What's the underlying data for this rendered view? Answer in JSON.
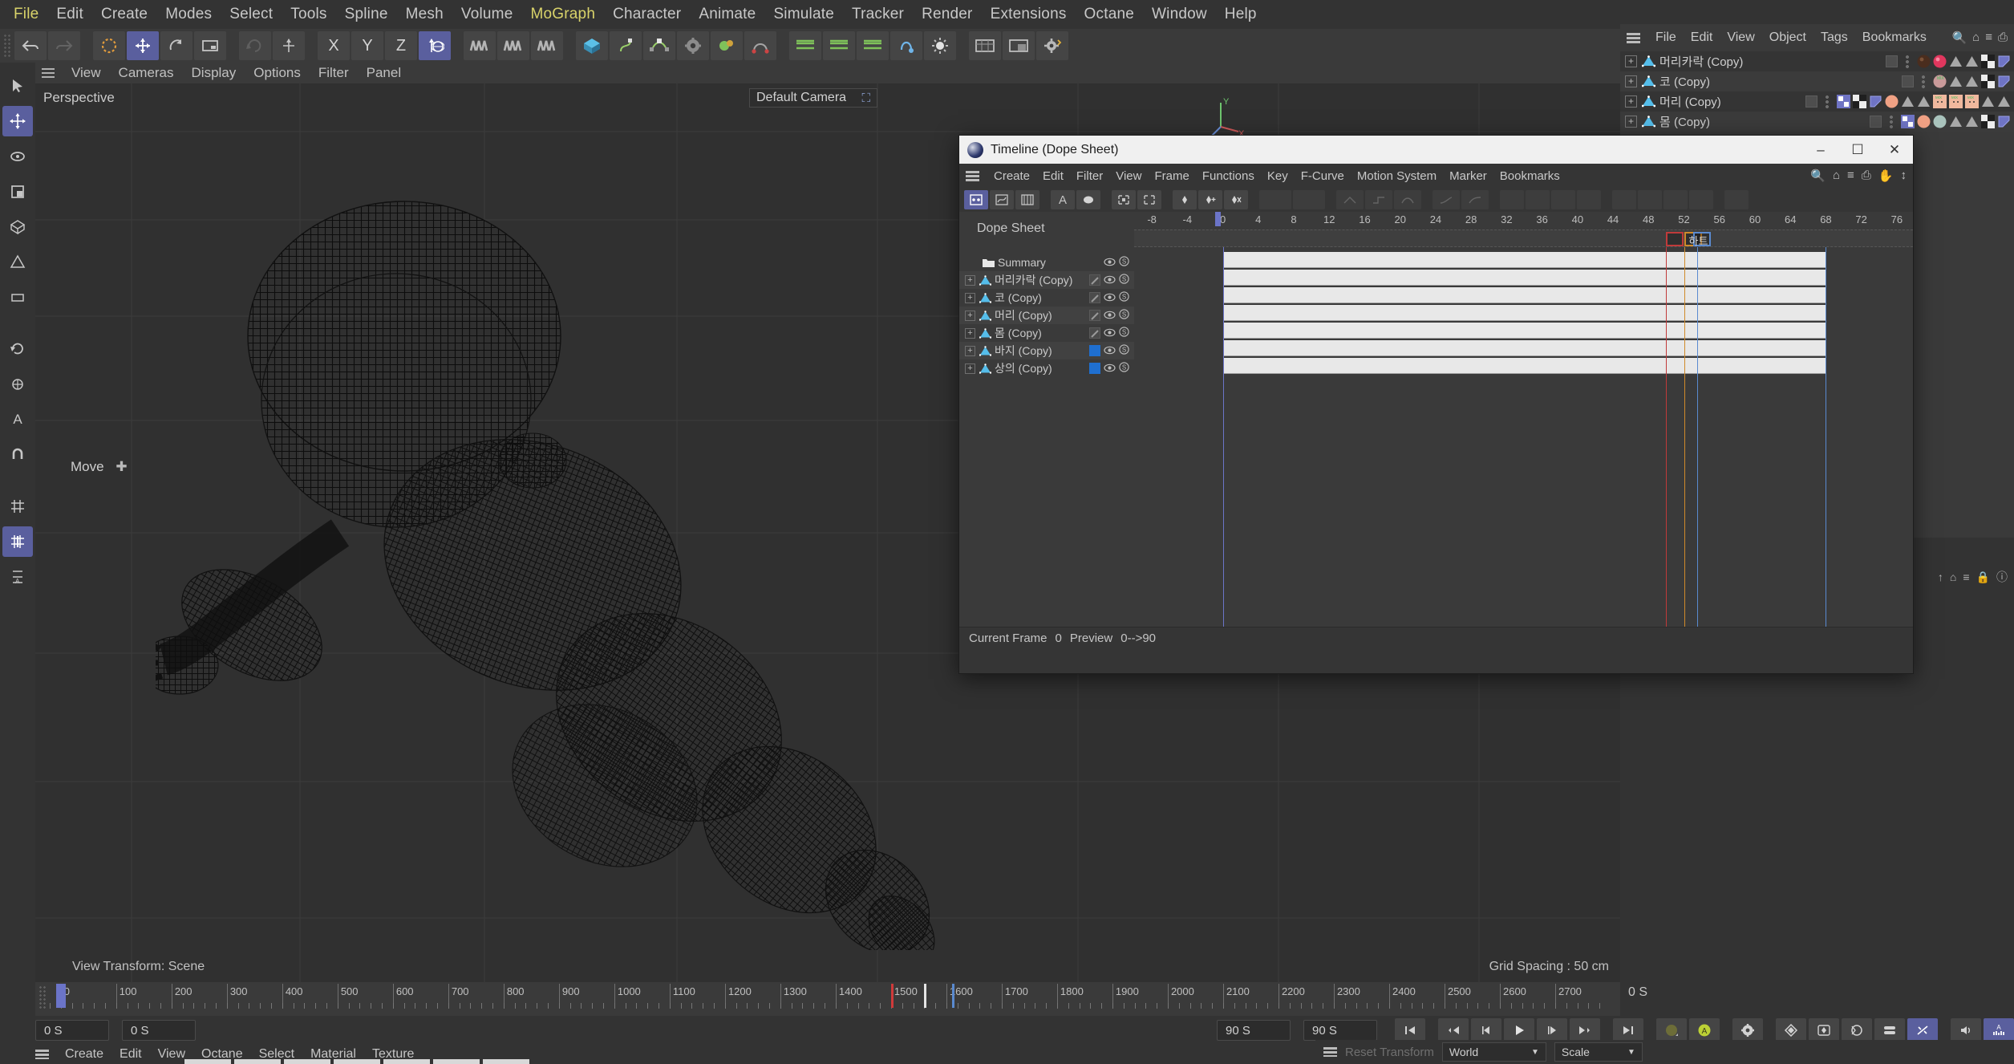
{
  "app": {
    "menu": [
      "File",
      "Edit",
      "Create",
      "Modes",
      "Select",
      "Tools",
      "Spline",
      "Mesh",
      "Volume",
      "MoGraph",
      "Character",
      "Animate",
      "Simulate",
      "Tracker",
      "Render",
      "Extensions",
      "Octane",
      "Window",
      "Help"
    ],
    "accent_menu": "MoGraph",
    "accent_color": "#d9d36a"
  },
  "viewport": {
    "header_menu": [
      "View",
      "Cameras",
      "Display",
      "Options",
      "Filter",
      "Panel"
    ],
    "perspective_label": "Perspective",
    "camera_value": "Default Camera",
    "tool_label": "Move",
    "view_transform": "View Transform: Scene",
    "grid_spacing": "Grid Spacing : 50 cm",
    "axis_labels": [
      "Y",
      "X",
      "Z"
    ]
  },
  "object_manager": {
    "menu": [
      "File",
      "Edit",
      "View",
      "Object",
      "Tags",
      "Bookmarks"
    ],
    "icons": [
      "search-icon",
      "home-icon",
      "filter-icon",
      "expand-icon"
    ],
    "rows": [
      {
        "name": "머리카락 (Copy)"
      },
      {
        "name": "코 (Copy)"
      },
      {
        "name": "머리 (Copy)"
      },
      {
        "name": "몸 (Copy)"
      }
    ]
  },
  "timeline": {
    "title": "Timeline (Dope Sheet)",
    "window_buttons": [
      "minimize",
      "maximize",
      "close"
    ],
    "menu": [
      "Create",
      "Edit",
      "Filter",
      "View",
      "Frame",
      "Functions",
      "Key",
      "F-Curve",
      "Motion System",
      "Marker",
      "Bookmarks"
    ],
    "icons": [
      "search-icon",
      "home-icon",
      "filter-icon",
      "popout-icon",
      "hand-icon",
      "updown-icon"
    ],
    "mode_label": "Dope Sheet",
    "rows": [
      {
        "name": "Summary",
        "type": "folder",
        "swatch": "none"
      },
      {
        "name": "머리카락 (Copy)",
        "type": "object",
        "swatch": "grey"
      },
      {
        "name": "코 (Copy)",
        "type": "object",
        "swatch": "grey"
      },
      {
        "name": "머리 (Copy)",
        "type": "object",
        "swatch": "grey"
      },
      {
        "name": "몸 (Copy)",
        "type": "object",
        "swatch": "grey"
      },
      {
        "name": "바지 (Copy)",
        "type": "object",
        "swatch": "blue"
      },
      {
        "name": "상의 (Copy)",
        "type": "object",
        "swatch": "blue"
      }
    ],
    "ruler_ticks": [
      "-8",
      "-4",
      "0",
      "4",
      "8",
      "12",
      "16",
      "20",
      "24",
      "28",
      "32",
      "36",
      "40",
      "44",
      "48",
      "52",
      "56",
      "60",
      "64",
      "68",
      "72",
      "76"
    ],
    "markers": [
      {
        "label": "",
        "color": "#c03a3a",
        "frame": 50
      },
      {
        "label": "",
        "color": "#d08a2a",
        "frame": 52
      },
      {
        "label": "",
        "color": "#5a8ad0",
        "frame": 53
      }
    ],
    "marker_text": "하트",
    "status": {
      "current_frame_label": "Current Frame",
      "current_frame": "0",
      "preview_label": "Preview",
      "preview_range": "0-->90"
    }
  },
  "bottom_bar": {
    "ruler_ticks": [
      "0",
      "100",
      "200",
      "300",
      "400",
      "500",
      "600",
      "700",
      "800",
      "900",
      "1000",
      "1100",
      "1200",
      "1300",
      "1400",
      "1500",
      "1600",
      "1700",
      "1800",
      "1900",
      "2000",
      "2100",
      "2200",
      "2300",
      "2400",
      "2500",
      "2600",
      "2700"
    ],
    "right_value": "0 S",
    "field_left": "0 S",
    "field_left2": "0 S",
    "field_right": "90 S",
    "field_right2": "90 S",
    "transport": [
      "go-to-start",
      "prev-key",
      "prev-frame",
      "play",
      "next-frame",
      "next-key",
      "go-to-end",
      "autokey-toggle",
      "record-active-objects",
      "keyframe-selection",
      "position-key",
      "rotation-key",
      "scale-key",
      "param-key",
      "point-level-anim",
      "sound-toggle",
      "animation-layers"
    ]
  },
  "material_bar": {
    "menu": [
      "Create",
      "Edit",
      "View",
      "Octane",
      "Select",
      "Material",
      "Texture"
    ]
  },
  "coordinate_bar": {
    "reset_label": "Reset Transform",
    "world_value": "World",
    "scale_value": "Scale"
  },
  "colors": {
    "selection_blue": "#5a5f9e",
    "accent_yellow": "#d9d36a",
    "swatch_blue": "#1f6fd0",
    "key_row": "#e8e8e8"
  }
}
